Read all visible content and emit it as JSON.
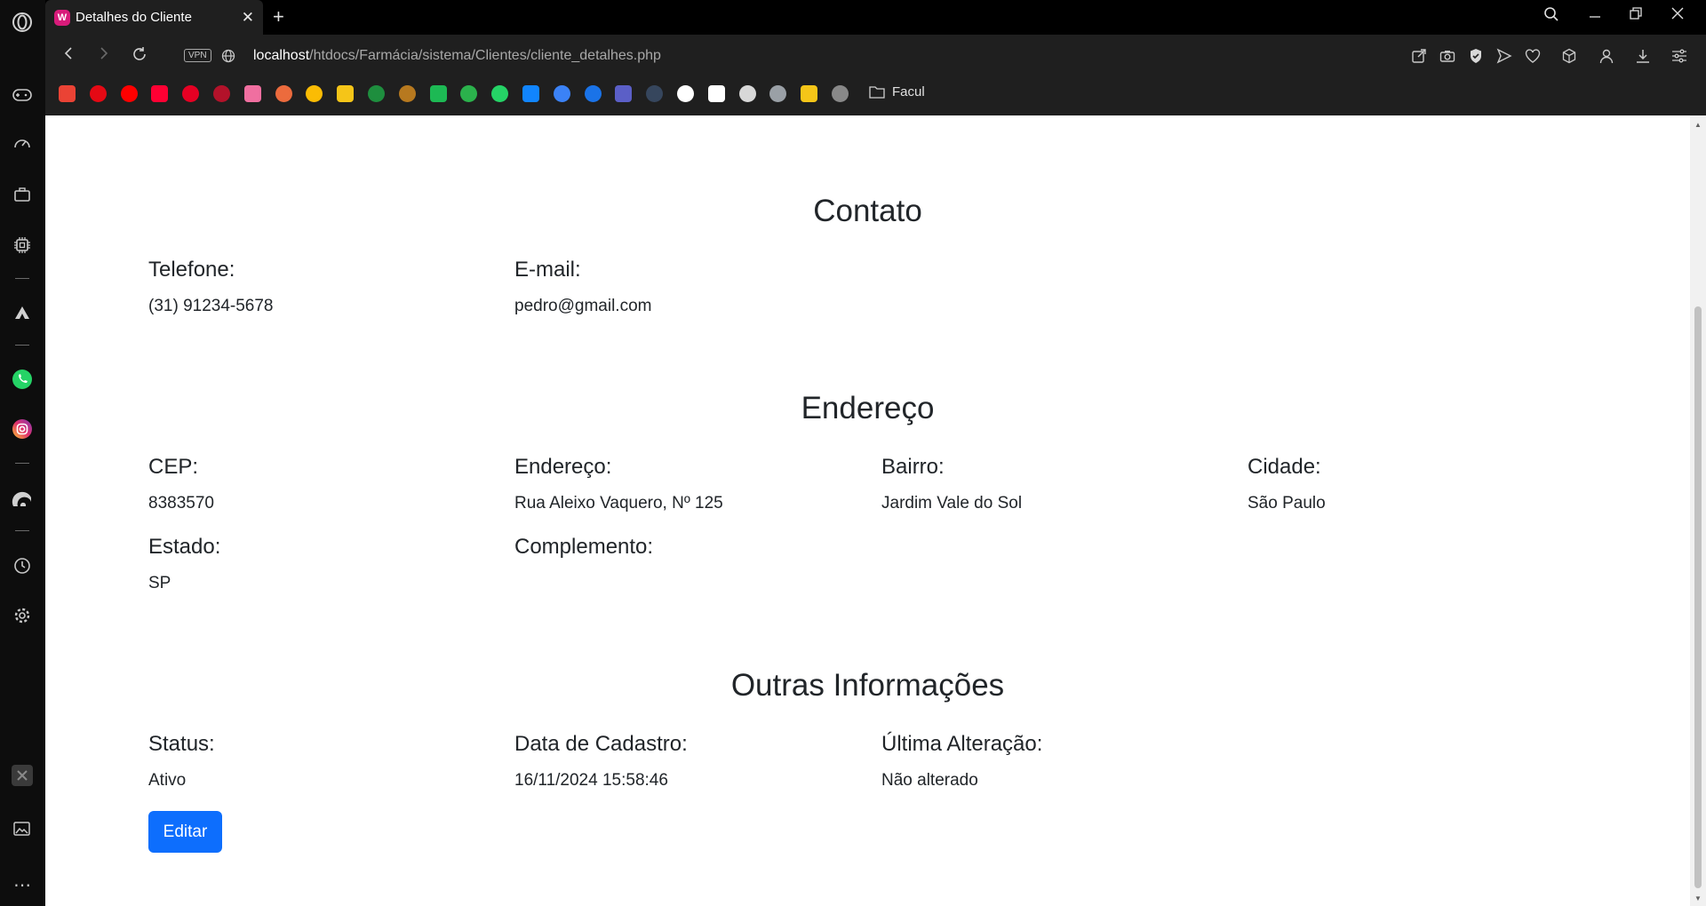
{
  "browser": {
    "tab_title": "Detalhes do Cliente",
    "tab_favicon_letter": "W",
    "url_host": "localhost",
    "url_path": "/htdocs/Farmácia/sistema/Clientes/cliente_detalhes.php",
    "vpn_label": "VPN",
    "bookmark_folder": "Facul",
    "bookmarks": [
      {
        "name": "gmail",
        "color": "#ea4335"
      },
      {
        "name": "netflix",
        "color": "#e50914"
      },
      {
        "name": "youtube",
        "color": "#ff0000"
      },
      {
        "name": "youtube-music",
        "color": "#ff0033"
      },
      {
        "name": "pinterest",
        "color": "#e60023"
      },
      {
        "name": "anime-site",
        "color": "#b3122a"
      },
      {
        "name": "pink-site",
        "color": "#f06fa0"
      },
      {
        "name": "red-site",
        "color": "#ec6b3d"
      },
      {
        "name": "keep",
        "color": "#fbbc04"
      },
      {
        "name": "crown-site",
        "color": "#f5c518"
      },
      {
        "name": "classroom",
        "color": "#1e8e3e"
      },
      {
        "name": "library-site",
        "color": "#b7791f"
      },
      {
        "name": "spotify",
        "color": "#1db954"
      },
      {
        "name": "feedly",
        "color": "#2bb24c"
      },
      {
        "name": "whatsapp",
        "color": "#25d366"
      },
      {
        "name": "bluesky",
        "color": "#1185fe"
      },
      {
        "name": "blue-site",
        "color": "#3b82f6"
      },
      {
        "name": "play-site",
        "color": "#1a73e8"
      },
      {
        "name": "teams",
        "color": "#5b5fc7"
      },
      {
        "name": "tumblr",
        "color": "#36465d"
      },
      {
        "name": "x",
        "color": "#ffffff"
      },
      {
        "name": "github",
        "color": "#ffffff"
      },
      {
        "name": "roblox",
        "color": "#d8d8d8"
      },
      {
        "name": "speed-site",
        "color": "#9aa0a6"
      },
      {
        "name": "letterboxd",
        "color": "#f5c518"
      },
      {
        "name": "cat-site",
        "color": "#888888"
      }
    ]
  },
  "sections": {
    "contato": {
      "title": "Contato",
      "telefone_label": "Telefone:",
      "telefone_value": "(31) 91234-5678",
      "email_label": "E-mail:",
      "email_value": "pedro@gmail.com"
    },
    "endereco": {
      "title": "Endereço",
      "cep_label": "CEP:",
      "cep_value": "8383570",
      "endereco_label": "Endereço:",
      "endereco_value": "Rua Aleixo Vaquero, Nº 125",
      "bairro_label": "Bairro:",
      "bairro_value": "Jardim Vale do Sol",
      "cidade_label": "Cidade:",
      "cidade_value": "São Paulo",
      "estado_label": "Estado:",
      "estado_value": "SP",
      "complemento_label": "Complemento:",
      "complemento_value": ""
    },
    "outras": {
      "title": "Outras Informações",
      "status_label": "Status:",
      "status_value": "Ativo",
      "cadastro_label": "Data de Cadastro:",
      "cadastro_value": "16/11/2024 15:58:46",
      "alteracao_label": "Última Alteração:",
      "alteracao_value": "Não alterado"
    }
  },
  "actions": {
    "edit_label": "Editar"
  },
  "colors": {
    "primary_button": "#0d6efd",
    "text": "#212529"
  }
}
